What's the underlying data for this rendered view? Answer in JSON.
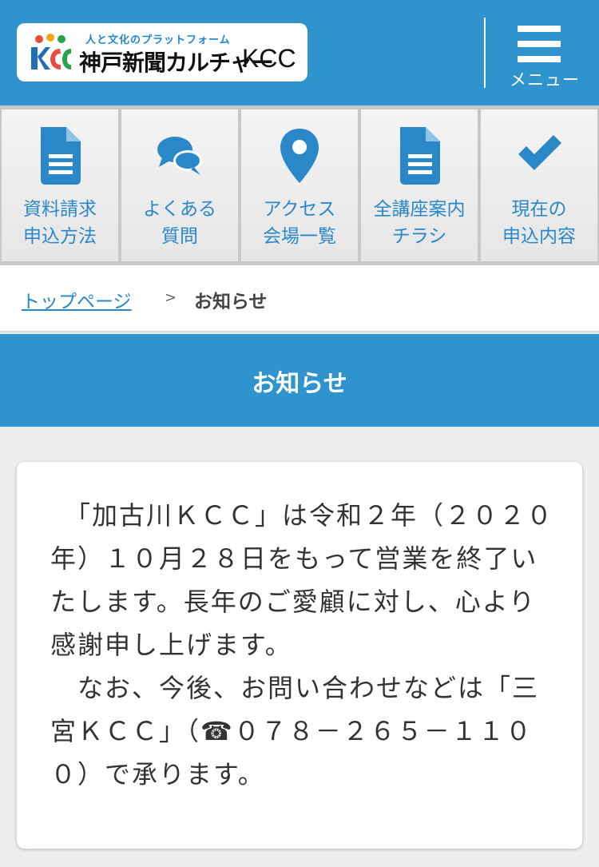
{
  "header": {
    "logo_tagline": "人と文化のプラットフォーム",
    "logo_name": "神戸新聞カルチャー",
    "logo_kcc": "KCC",
    "menu_label": "メニュー",
    "colors": {
      "header_bg": "#2f93cd",
      "accent": "#2a88c8"
    }
  },
  "nav": {
    "items": [
      {
        "label": "資料請求\n申込方法",
        "icon": "document-icon"
      },
      {
        "label": "よくある\n質問",
        "icon": "chat-bubbles-icon"
      },
      {
        "label": "アクセス\n会場一覧",
        "icon": "map-pin-icon"
      },
      {
        "label": "全講座案内\nチラシ",
        "icon": "document-icon"
      },
      {
        "label": "現在の\n申込内容",
        "icon": "checkmark-icon"
      }
    ]
  },
  "breadcrumb": {
    "home": "トップページ",
    "separator": ">",
    "current": "お知らせ"
  },
  "page": {
    "title": "お知らせ"
  },
  "notice": {
    "paragraph1": "　「加古川ＫＣＣ」は令和２年（２０２０年）１０月２８日をもって営業を終了いたします。長年のご愛顧に対し、心より感謝申し上げます。",
    "paragraph2": "　なお、今後、お問い合わせなどは「三宮ＫＣＣ」（☎０７８－２６５－１１００）で承ります。"
  }
}
